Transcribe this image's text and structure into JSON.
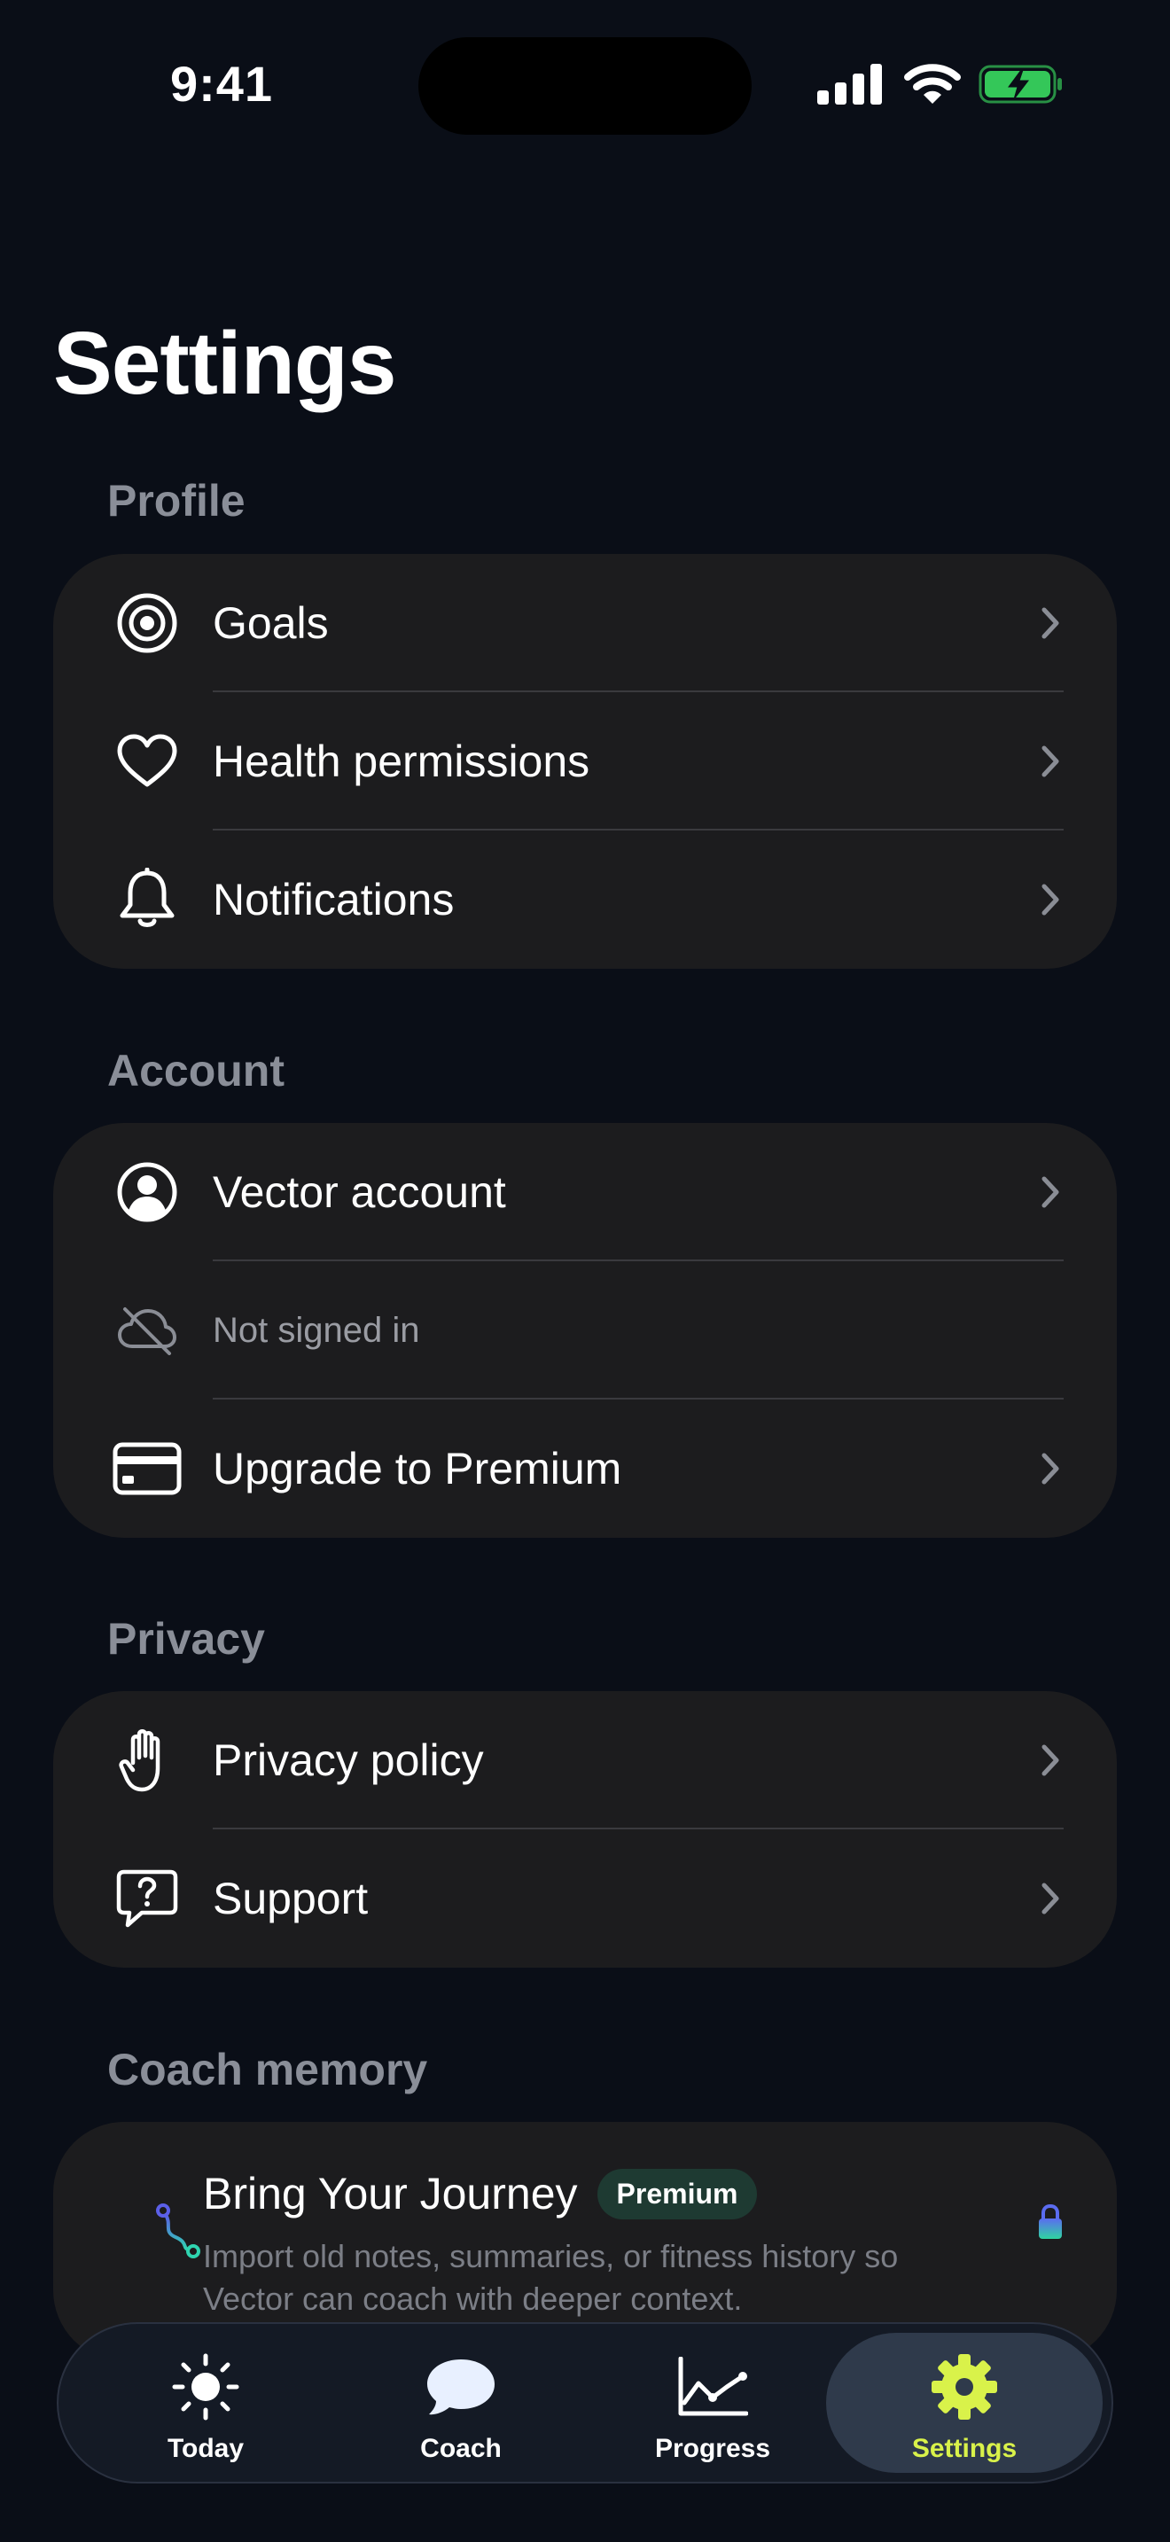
{
  "status_bar": {
    "time": "9:41"
  },
  "title": "Settings",
  "sections": {
    "profile": {
      "header": "Profile",
      "rows": [
        {
          "label": "Goals",
          "icon": "target-icon"
        },
        {
          "label": "Health permissions",
          "icon": "heart-icon"
        },
        {
          "label": "Notifications",
          "icon": "bell-icon"
        }
      ]
    },
    "account": {
      "header": "Account",
      "rows": [
        {
          "label": "Vector account",
          "icon": "person-circle-icon"
        },
        {
          "label": "Not signed in",
          "icon": "cloud-off-icon"
        },
        {
          "label": "Upgrade to Premium",
          "icon": "credit-card-icon"
        }
      ]
    },
    "privacy": {
      "header": "Privacy",
      "rows": [
        {
          "label": "Privacy policy",
          "icon": "hand-icon"
        },
        {
          "label": "Support",
          "icon": "question-bubble-icon"
        }
      ]
    },
    "coach_memory": {
      "header": "Coach memory",
      "journey": {
        "title": "Bring Your Journey",
        "badge": "Premium",
        "description": "Import old notes, summaries, or fitness history so Vector can coach with deeper context.",
        "icon": "route-icon",
        "lock_icon": "lock-icon"
      }
    }
  },
  "tabs": [
    {
      "label": "Today",
      "icon": "sun-icon",
      "active": false
    },
    {
      "label": "Coach",
      "icon": "speech-bubble-icon",
      "active": false
    },
    {
      "label": "Progress",
      "icon": "chart-line-icon",
      "active": false
    },
    {
      "label": "Settings",
      "icon": "gear-icon",
      "active": true
    }
  ],
  "colors": {
    "background": "#0a0e17",
    "card": "#1c1c1e",
    "section_header": "#8a8e98",
    "accent": "#d9f24a",
    "battery": "#34c759"
  }
}
